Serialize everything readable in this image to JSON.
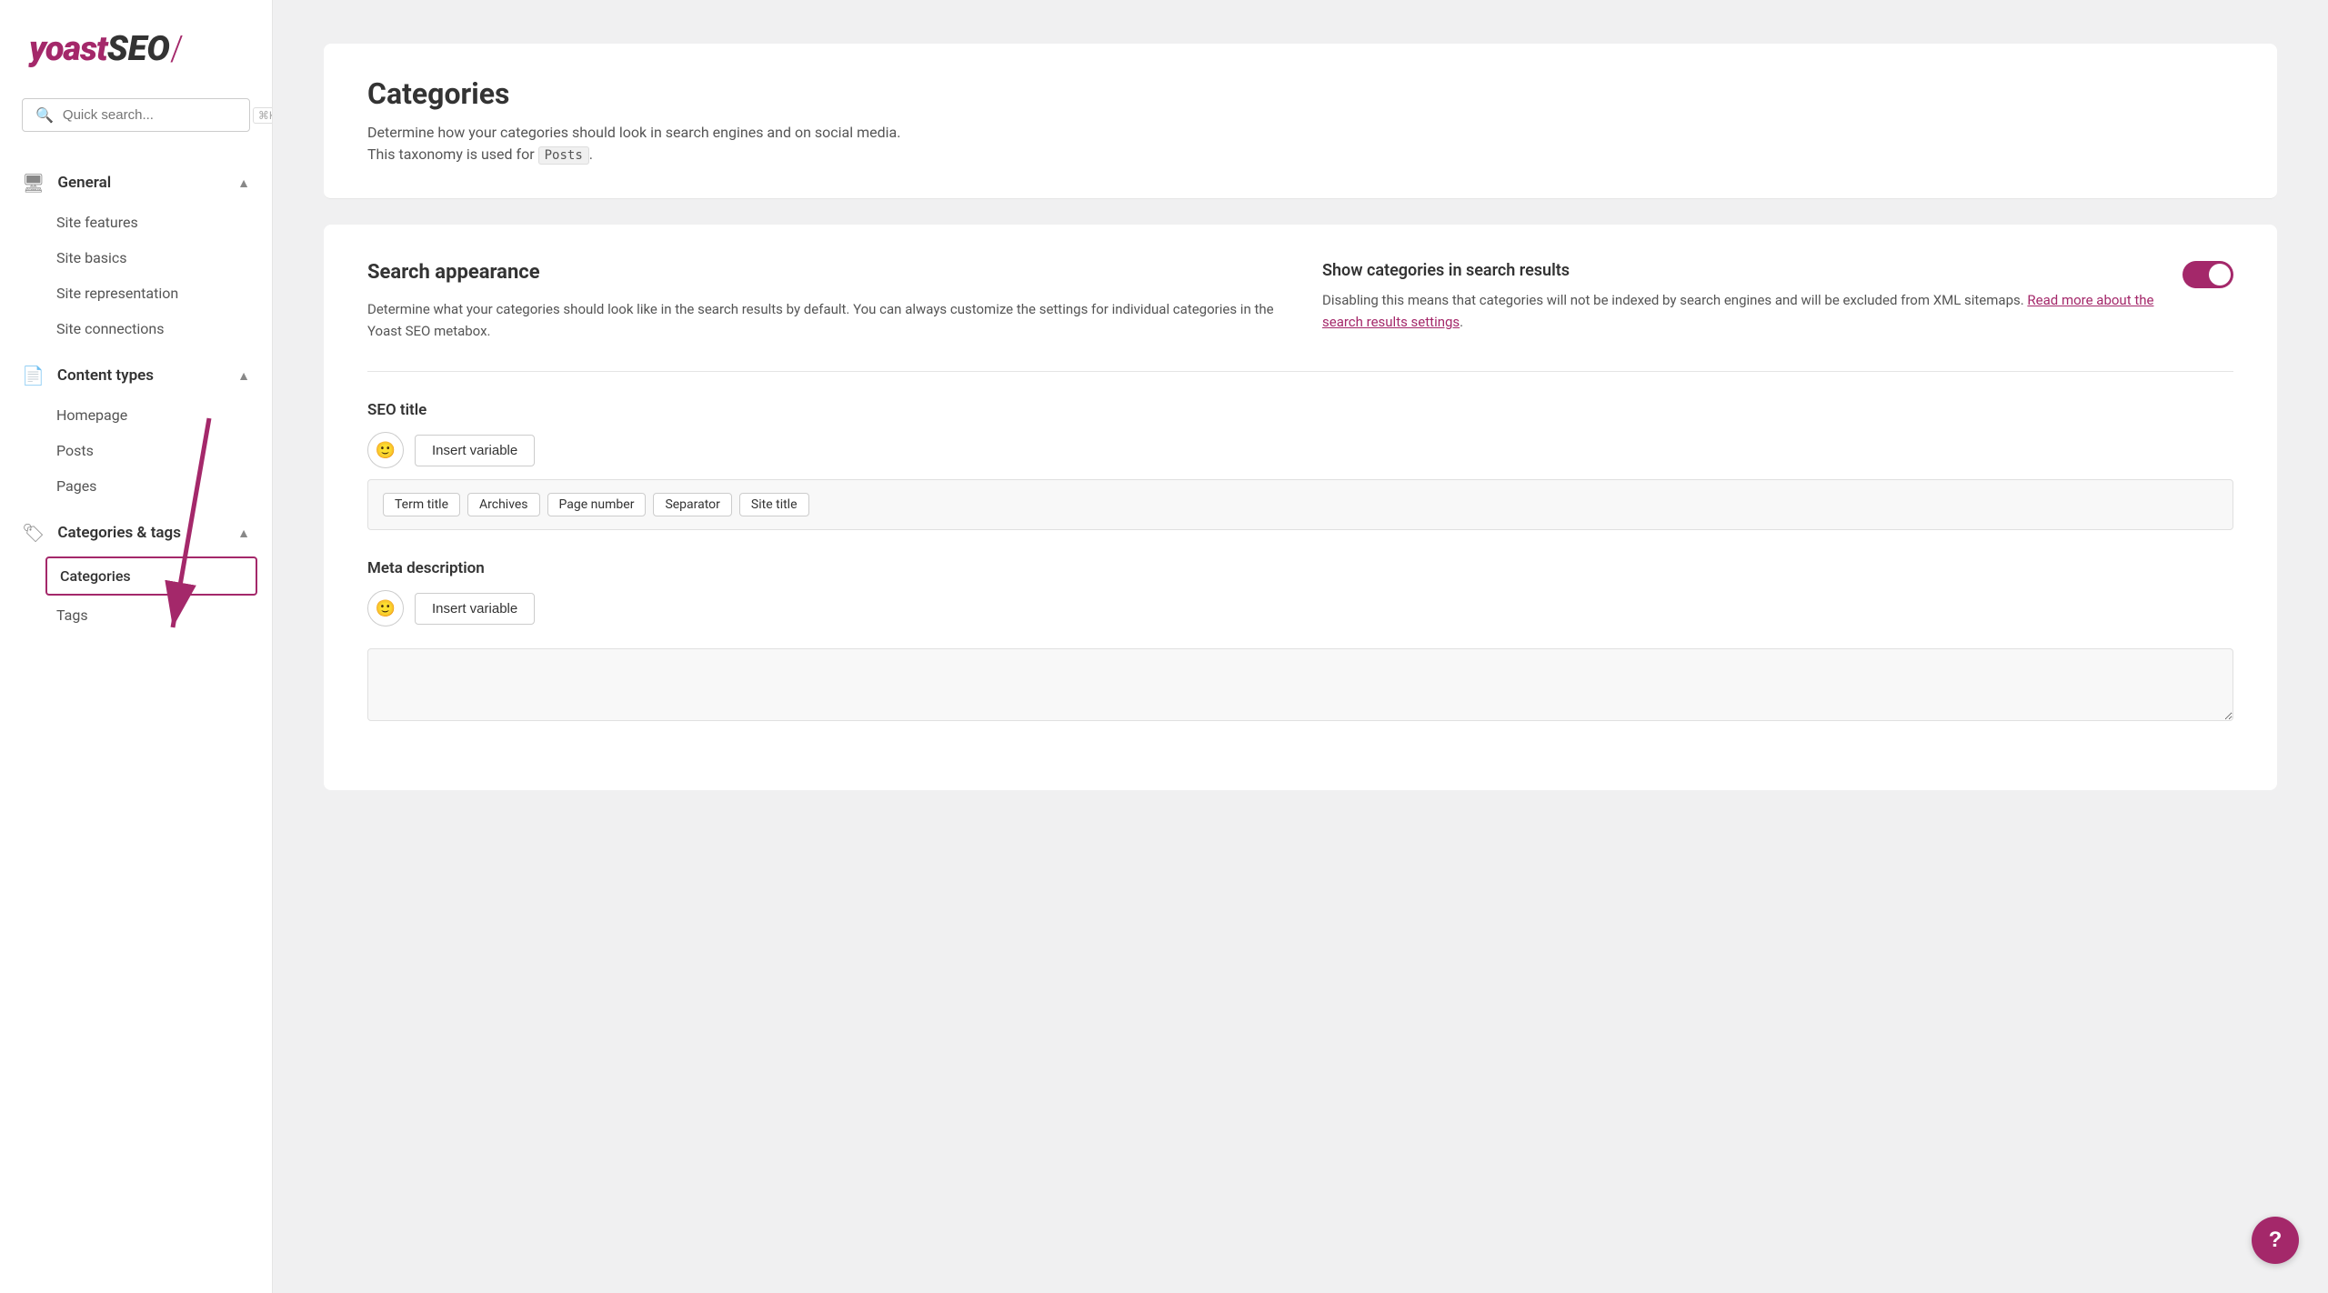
{
  "logo": {
    "yoast": "yoast",
    "seo": "SEO",
    "slash": "/"
  },
  "search": {
    "placeholder": "Quick search...",
    "shortcut": "⌘K"
  },
  "sidebar": {
    "sections": [
      {
        "id": "general",
        "icon": "🖥",
        "title": "General",
        "expanded": true,
        "items": [
          {
            "id": "site-features",
            "label": "Site features",
            "active": false
          },
          {
            "id": "site-basics",
            "label": "Site basics",
            "active": false
          },
          {
            "id": "site-representation",
            "label": "Site representation",
            "active": false
          },
          {
            "id": "site-connections",
            "label": "Site connections",
            "active": false
          }
        ]
      },
      {
        "id": "content-types",
        "icon": "📄",
        "title": "Content types",
        "expanded": true,
        "items": [
          {
            "id": "homepage",
            "label": "Homepage",
            "active": false
          },
          {
            "id": "posts",
            "label": "Posts",
            "active": false
          },
          {
            "id": "pages",
            "label": "Pages",
            "active": false
          }
        ]
      },
      {
        "id": "categories-tags",
        "icon": "🏷",
        "title": "Categories & tags",
        "expanded": true,
        "items": [
          {
            "id": "categories",
            "label": "Categories",
            "active": true
          },
          {
            "id": "tags",
            "label": "Tags",
            "active": false
          }
        ]
      }
    ]
  },
  "page": {
    "title": "Categories",
    "subtitle": "Determine how your categories should look in search engines and on social media.",
    "taxonomy_note": "This taxonomy is used for",
    "taxonomy_type": "Posts",
    "taxonomy_suffix": "."
  },
  "search_appearance": {
    "heading": "Search appearance",
    "description": "Determine what your categories should look like in the search results by default. You can always customize the settings for individual categories in the Yoast SEO metabox.",
    "toggle_label": "Show categories in search results",
    "toggle_description": "Disabling this means that categories will not be indexed by search engines and will be excluded from XML sitemaps.",
    "toggle_link_text": "Read more about the search results settings",
    "toggle_link": "#",
    "toggle_enabled": true
  },
  "seo_title": {
    "label": "SEO title",
    "insert_btn": "Insert variable",
    "tags": [
      "Term title",
      "Archives",
      "Page number",
      "Separator",
      "Site title"
    ]
  },
  "meta_description": {
    "label": "Meta description",
    "insert_btn": "Insert variable",
    "placeholder": ""
  },
  "help_btn": "?"
}
